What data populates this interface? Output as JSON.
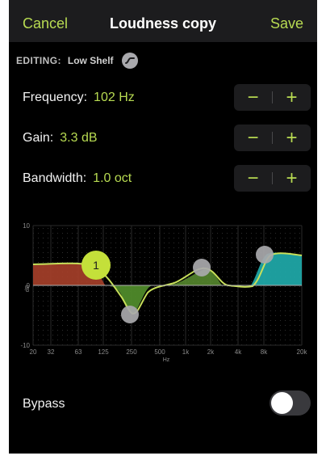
{
  "navbar": {
    "cancel_label": "Cancel",
    "title": "Loudness copy",
    "save_label": "Save"
  },
  "editing": {
    "label": "EDITING:",
    "value": "Low Shelf",
    "icon": "filter-shape-icon"
  },
  "params": [
    {
      "label": "Frequency:",
      "value": "102 Hz",
      "minus": "−",
      "plus": "+"
    },
    {
      "label": "Gain:",
      "value": "3.3 dB",
      "minus": "−",
      "plus": "+"
    },
    {
      "label": "Bandwidth:",
      "value": "1.0 oct",
      "minus": "−",
      "plus": "+"
    }
  ],
  "graph": {
    "y_ticks": [
      "10",
      "0",
      "-10"
    ],
    "y_unit": "dB",
    "x_ticks": [
      "20",
      "32",
      "63",
      "125",
      "250",
      "500",
      "1k",
      "2k",
      "4k",
      "8k",
      "20k"
    ],
    "x_unit": "Hz",
    "active_node_label": "1"
  },
  "bypass": {
    "label": "Bypass",
    "on": false
  },
  "colors": {
    "accent": "#b8db52",
    "background": "#000000",
    "navbar": "#1c1c1e",
    "low_shelf_fill": "#a8402a",
    "peak_fill": "#4f8a2a",
    "high_shelf_fill": "#1fa5a5",
    "node_gray": "#a9a9ad"
  }
}
